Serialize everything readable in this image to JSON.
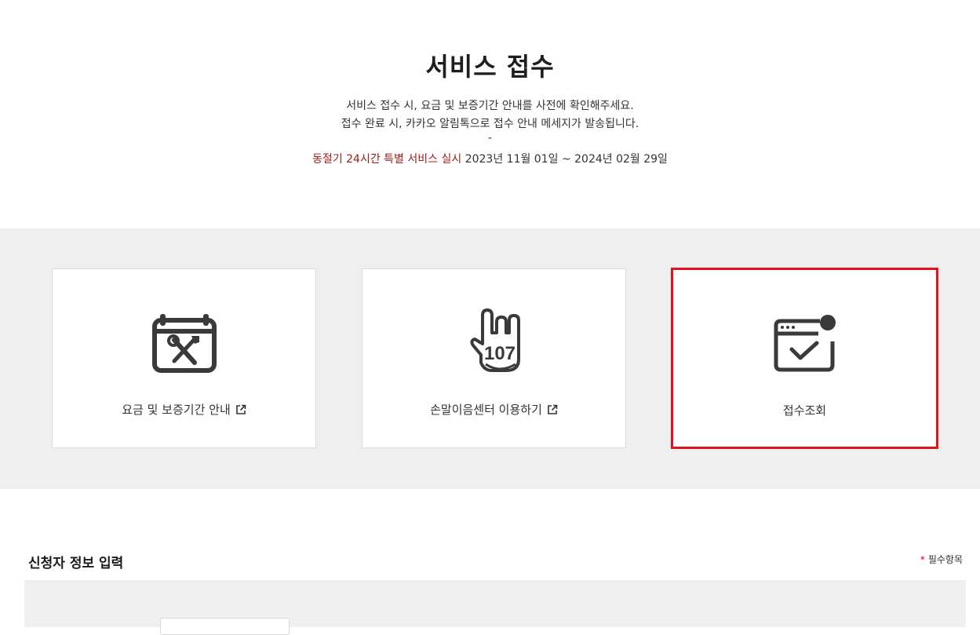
{
  "header": {
    "title": "서비스 접수",
    "line1": "서비스 접수 시, 요금 및 보증기간 안내를 사전에 확인해주세요.",
    "line2": "접수 완료 시, 카카오 알림톡으로 접수 안내 메세지가 발송됩니다.",
    "divider": "-",
    "notice_highlight": "동절기 24시간 특별 서비스 실시",
    "notice_period": " 2023년 11월 01일 ~ 2024년 02월 29일"
  },
  "cards": [
    {
      "label": "요금 및 보증기간 안내",
      "icon": "calendar-tools-icon",
      "external": true
    },
    {
      "label": "손말이음센터 이용하기",
      "icon": "sign-language-107-icon",
      "badge": "107",
      "external": true
    },
    {
      "label": "접수조회",
      "icon": "browser-check-icon",
      "external": false
    }
  ],
  "form": {
    "section_title": "신청자 정보 입력",
    "required_mark": "*",
    "required_label": "필수항목"
  },
  "colors": {
    "accent_red": "#a01c1c",
    "highlight_border": "#e2141b",
    "band_gray": "#efefef"
  }
}
